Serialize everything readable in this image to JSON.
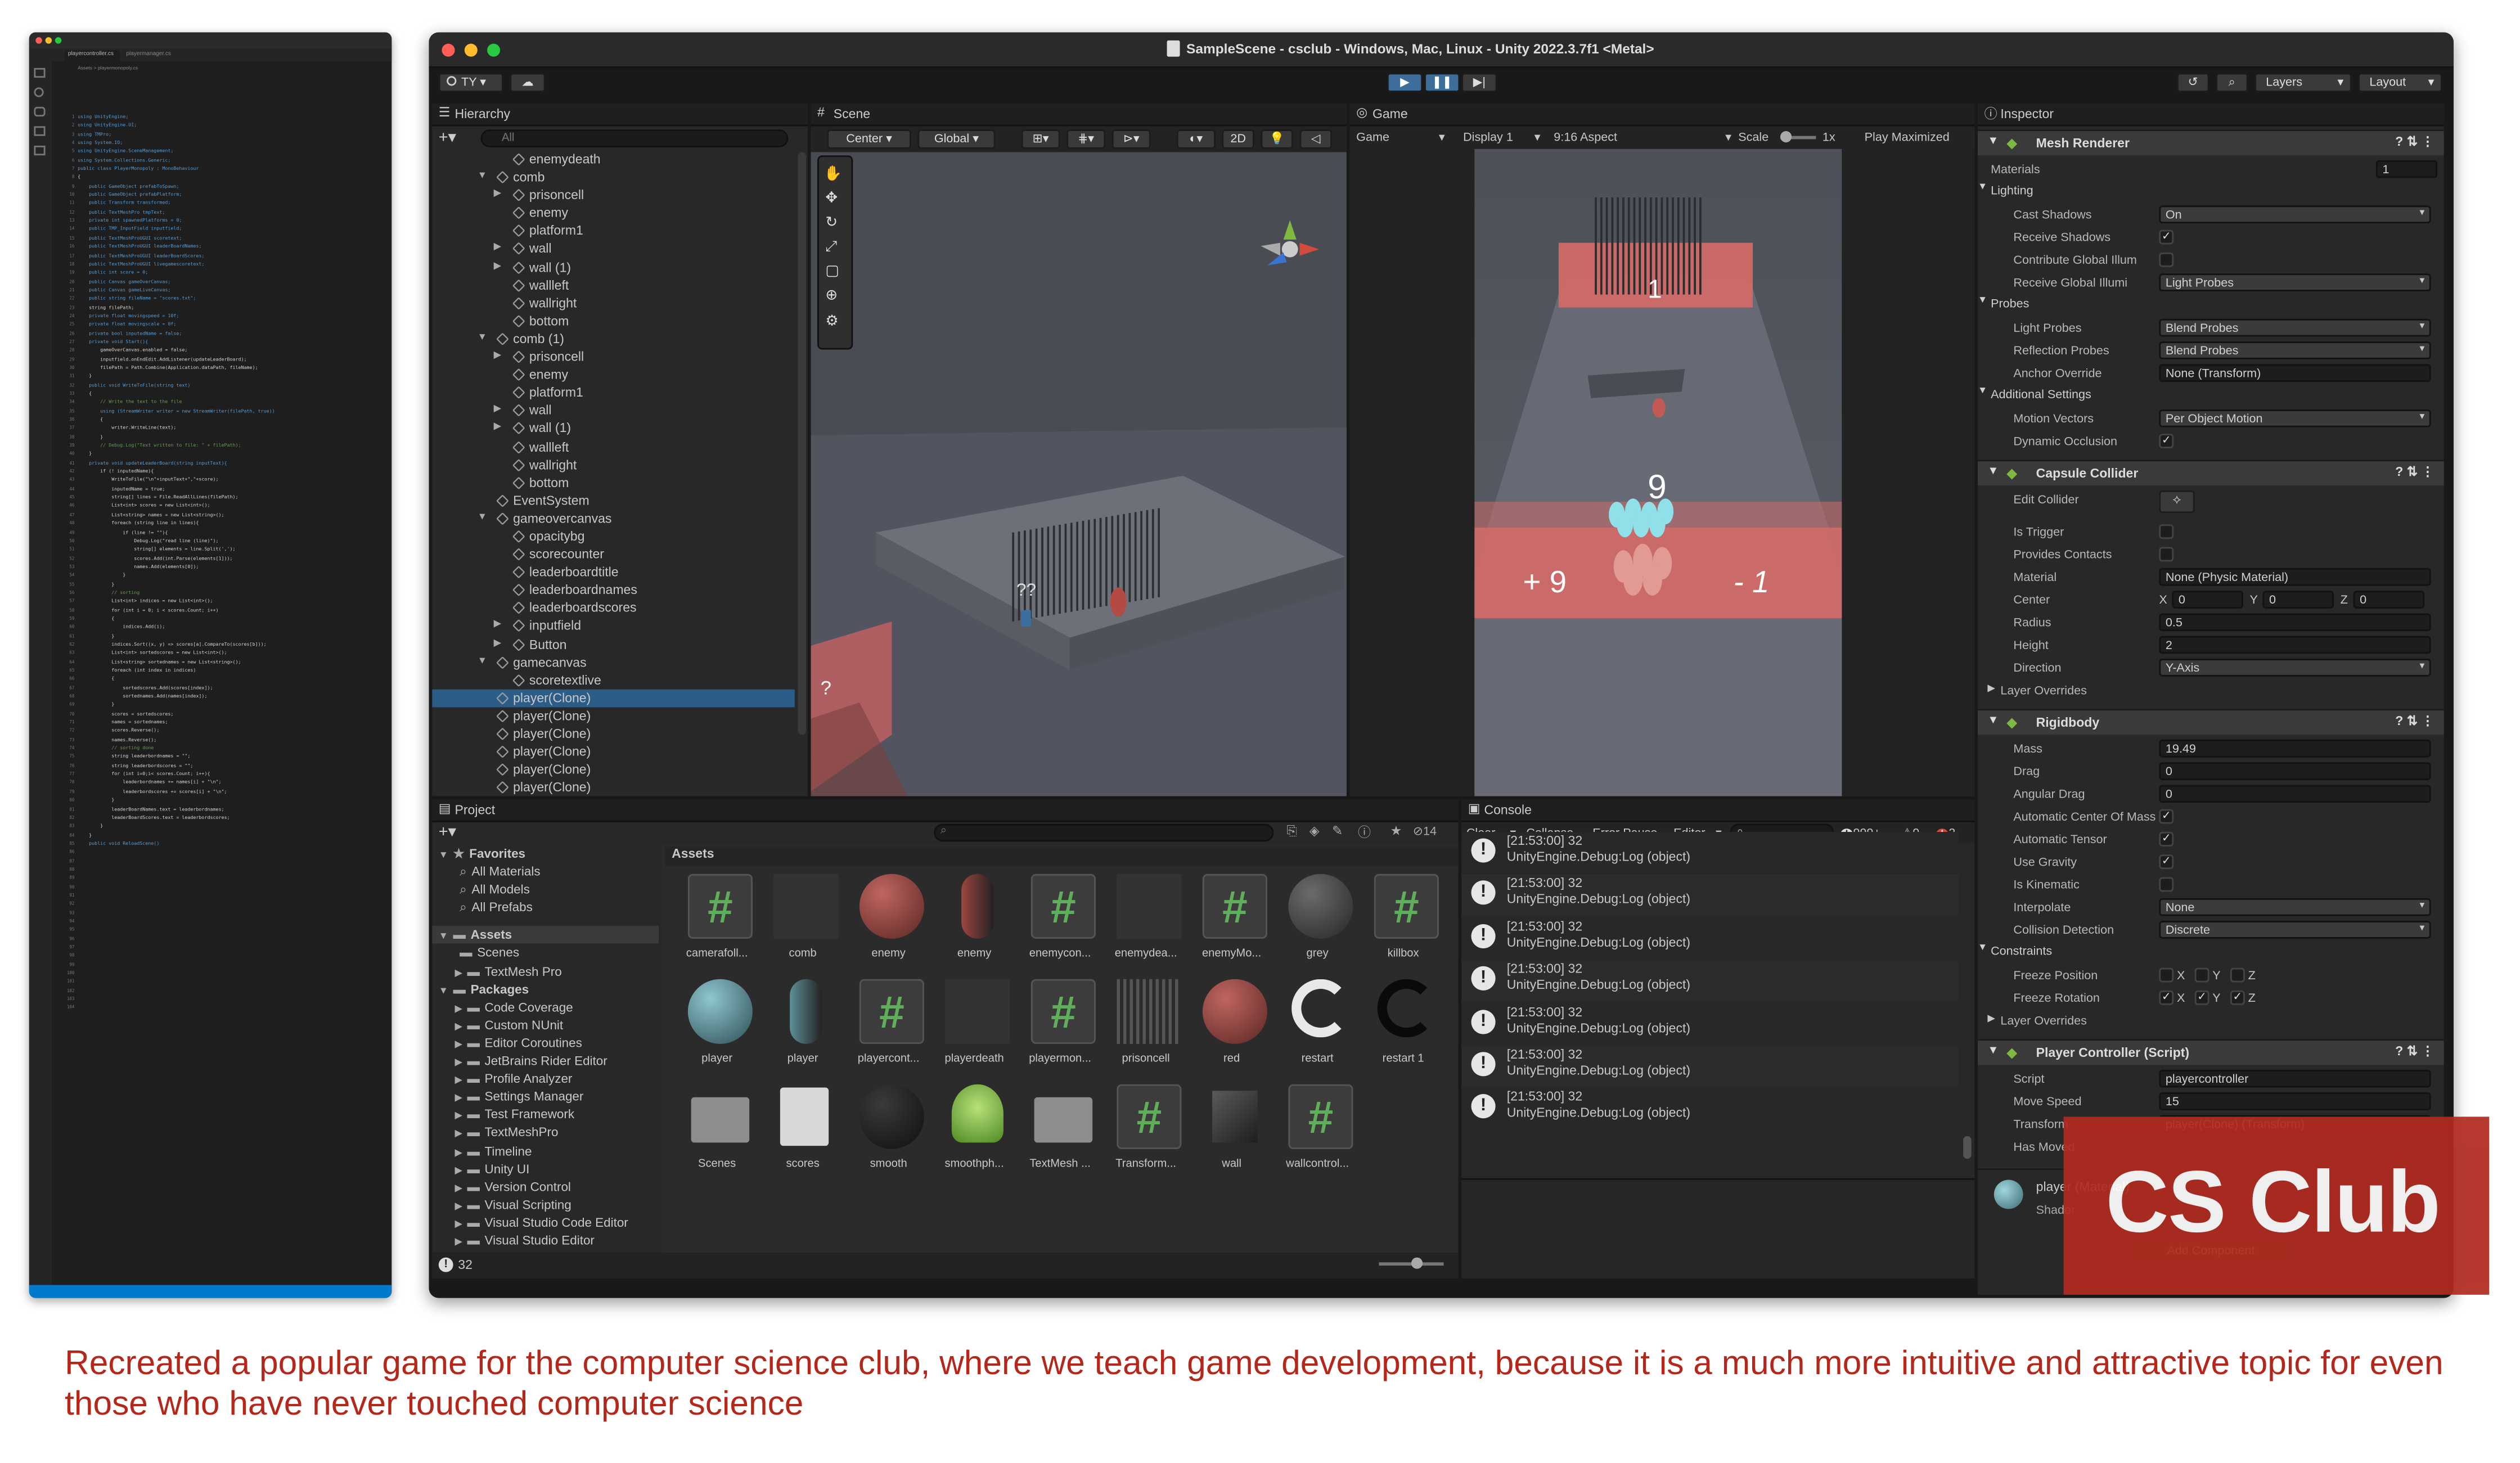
{
  "code_editor": {
    "tab1": "playercontroller.cs",
    "tab2": "playermanager.cs",
    "breadcrumb": "Assets > playermonopoly.cs",
    "lines": [
      "using UnityEngine;",
      "using UnityEngine.UI;",
      "using TMPro;",
      "using System.IO;",
      "using UnityEngine.SceneManagement;",
      "using System.Collections.Generic;",
      "",
      "public class PlayerMonopoly : MonoBehaviour",
      "{",
      "    public GameObject prefabToSpawn;",
      "    public GameObject prefabPlatform;",
      "    public Transform transformed;",
      "    public TextMeshPro tmpText;",
      "    private int spawnedPlatforms = 0;",
      "",
      "    public TMP_InputField inputfield;",
      "    public TextMeshProUGUI scoretext;",
      "    public TextMeshProUGUI leaderBoardNames;",
      "    public TextMeshProUGUI leaderBoardScores;",
      "",
      "    public TextMeshProUGUI livegamescoretext;",
      "",
      "    public int score = 0;",
      "",
      "    public Canvas gameOverCanvas;",
      "    public Canvas gameLiveCanvas;",
      "    public string fileName = \"scores.txt\";",
      "    string filePath;",
      "",
      "    private float movingspeed = 10f;",
      "    private float movingscale = 0f;",
      "",
      "    private bool inputedName = false;",
      "",
      "    private void Start(){",
      "        gameOverCanvas.enabled = false;",
      "        inputfield.onEndEdit.AddListener(updateLeaderBoard);",
      "        filePath = Path.Combine(Application.dataPath, fileName);",
      "    }",
      "",
      "    public void WriteToFile(string text)",
      "    {",
      "        // Write the text to the file",
      "        using (StreamWriter writer = new StreamWriter(filePath, true))",
      "        {",
      "            writer.WriteLine(text);",
      "        }",
      "",
      "        // Debug.Log(\"Text written to file: \" + filePath);",
      "    }",
      "",
      "    private void updateLeaderBoard(string inputText){",
      "        if (! inputedName){",
      "            WriteToFile(\"\\n\"+inputText+\",\"+score);",
      "            inputedName = true;",
      "            string[] lines = File.ReadAllLines(filePath);",
      "            List<int> scores = new List<int>();",
      "            List<string> names = new List<string>();",
      "            foreach (string line in lines){",
      "                if (line != \"\"){",
      "                    Debug.Log(\"read line (line)\");",
      "                    string[] elements = line.Split(',');",
      "                    scores.Add(int.Parse(elements[1]));",
      "                    names.Add(elements[0]);",
      "                }",
      "            }",
      "",
      "            // sorting",
      "            List<int> indices = new List<int>();",
      "            for (int i = 0; i < scores.Count; i++)",
      "            {",
      "                indices.Add(i);",
      "            }",
      "",
      "            indices.Sort((x, y) => scores[a].CompareTo(scores[b]));",
      "",
      "            List<int> sortedscores = new List<int>();",
      "            List<string> sortednames = new List<string>();",
      "",
      "            foreach (int index in indices)",
      "            {",
      "                sortedscores.Add(scores[index]);",
      "                sortednames.Add(names[index]);",
      "            }",
      "",
      "            scores = sortedscores;",
      "            names = sortednames;",
      "",
      "            scores.Reverse();",
      "            names.Reverse();",
      "",
      "            // sorting done",
      "            string leaderbordnames = \"\";",
      "            string leaderbordscores = \"\";",
      "            for (int i=0;i< scores.Count; i++){",
      "                leaderbordnames += names[i] + \"\\n\";",
      "                leaderbordscores += scores[i] + \"\\n\";",
      "            }",
      "            leaderBoardNames.text = leaderbordnames;",
      "            leaderBoardScores.text = leaderbordscores;",
      "        }",
      "    }",
      "",
      "    public void ReloadScene()"
    ]
  },
  "unity": {
    "title": "SampleScene - csclub - Windows, Mac, Linux - Unity 2022.3.7f1 <Metal>",
    "account": "TY",
    "layers_label": "Layers",
    "layout_label": "Layout",
    "hierarchy": {
      "tab": "Hierarchy",
      "search_placeholder": "All",
      "items": [
        {
          "label": "enemydeath",
          "indent": 2
        },
        {
          "label": "comb",
          "indent": 1
        },
        {
          "label": "prisoncell",
          "indent": 2
        },
        {
          "label": "enemy",
          "indent": 2
        },
        {
          "label": "platform1",
          "indent": 2
        },
        {
          "label": "wall",
          "indent": 2
        },
        {
          "label": "wall (1)",
          "indent": 2
        },
        {
          "label": "wallleft",
          "indent": 2
        },
        {
          "label": "wallright",
          "indent": 2
        },
        {
          "label": "bottom",
          "indent": 2
        },
        {
          "label": "comb (1)",
          "indent": 1
        },
        {
          "label": "prisoncell",
          "indent": 2
        },
        {
          "label": "enemy",
          "indent": 2
        },
        {
          "label": "platform1",
          "indent": 2
        },
        {
          "label": "wall",
          "indent": 2
        },
        {
          "label": "wall (1)",
          "indent": 2
        },
        {
          "label": "wallleft",
          "indent": 2
        },
        {
          "label": "wallright",
          "indent": 2
        },
        {
          "label": "bottom",
          "indent": 2
        },
        {
          "label": "EventSystem",
          "indent": 1
        },
        {
          "label": "gameovercanvas",
          "indent": 1
        },
        {
          "label": "opacitybg",
          "indent": 2
        },
        {
          "label": "scorecounter",
          "indent": 2
        },
        {
          "label": "leaderboardtitle",
          "indent": 2
        },
        {
          "label": "leaderboardnames",
          "indent": 2
        },
        {
          "label": "leaderboardscores",
          "indent": 2
        },
        {
          "label": "inputfield",
          "indent": 2
        },
        {
          "label": "Button",
          "indent": 2
        },
        {
          "label": "gamecanvas",
          "indent": 1
        },
        {
          "label": "scoretextlive",
          "indent": 2
        },
        {
          "label": "player(Clone)",
          "indent": 1,
          "selected": true
        },
        {
          "label": "player(Clone)",
          "indent": 1
        },
        {
          "label": "player(Clone)",
          "indent": 1
        },
        {
          "label": "player(Clone)",
          "indent": 1
        },
        {
          "label": "player(Clone)",
          "indent": 1
        },
        {
          "label": "player(Clone)",
          "indent": 1
        }
      ]
    },
    "scene": {
      "tab": "Scene",
      "pivot": "Center",
      "space": "Global",
      "mode_2d": "2D"
    },
    "game": {
      "tab": "Game",
      "mode": "Game",
      "display": "Display 1",
      "aspect": "9:16 Aspect",
      "scale_label": "Scale",
      "scale_value": "1x",
      "play_mode": "Play Maximized",
      "gate_top": "1",
      "count_above": "9",
      "gate_left": "+ 9",
      "gate_right": "- 1"
    },
    "project": {
      "tab": "Project",
      "favorites_label": "Favorites",
      "favorites": [
        "All Materials",
        "All Models",
        "All Prefabs"
      ],
      "assets_label": "Assets",
      "asset_folders": [
        "Scenes",
        "TextMesh Pro"
      ],
      "packages_label": "Packages",
      "packages": [
        "Code Coverage",
        "Custom NUnit",
        "Editor Coroutines",
        "JetBrains Rider Editor",
        "Profile Analyzer",
        "Settings Manager",
        "Test Framework",
        "TextMeshPro",
        "Timeline",
        "Unity UI",
        "Version Control",
        "Visual Scripting",
        "Visual Studio Code Editor",
        "Visual Studio Editor"
      ],
      "grid_title": "Assets",
      "hidden_count": "14",
      "assets": [
        {
          "name": "camerafoll...",
          "kind": "script"
        },
        {
          "name": "comb",
          "kind": "prefab"
        },
        {
          "name": "enemy",
          "kind": "sphere-red"
        },
        {
          "name": "enemy",
          "kind": "capsule-red"
        },
        {
          "name": "enemycon...",
          "kind": "script"
        },
        {
          "name": "enemydea...",
          "kind": "dark"
        },
        {
          "name": "enemyMo...",
          "kind": "script"
        },
        {
          "name": "grey",
          "kind": "sphere-grey"
        },
        {
          "name": "killbox",
          "kind": "script"
        },
        {
          "name": "player",
          "kind": "sphere-teal"
        },
        {
          "name": "player",
          "kind": "capsule-teal"
        },
        {
          "name": "playercont...",
          "kind": "script"
        },
        {
          "name": "playerdeath",
          "kind": "dark"
        },
        {
          "name": "playermon...",
          "kind": "script"
        },
        {
          "name": "prisoncell",
          "kind": "cage"
        },
        {
          "name": "red",
          "kind": "sphere-red"
        },
        {
          "name": "restart",
          "kind": "restart-white"
        },
        {
          "name": "restart 1",
          "kind": "restart-black"
        },
        {
          "name": "Scenes",
          "kind": "folder"
        },
        {
          "name": "scores",
          "kind": "doc"
        },
        {
          "name": "smooth",
          "kind": "sphere-black"
        },
        {
          "name": "smoothph...",
          "kind": "physic"
        },
        {
          "name": "TextMesh ...",
          "kind": "folder"
        },
        {
          "name": "Transform...",
          "kind": "script"
        },
        {
          "name": "wall",
          "kind": "dark-cube"
        },
        {
          "name": "wallcontrol...",
          "kind": "script"
        }
      ],
      "status_count": "32"
    },
    "console": {
      "tab": "Console",
      "clear": "Clear",
      "collapse": "Collapse",
      "error_pause": "Error Pause",
      "editor": "Editor",
      "log_count": "999+",
      "warn_count": "0",
      "error_count": "2",
      "entries": [
        {
          "time": "[21:53:00] 32",
          "msg": "UnityEngine.Debug:Log (object)"
        },
        {
          "time": "[21:53:00] 32",
          "msg": "UnityEngine.Debug:Log (object)"
        },
        {
          "time": "[21:53:00] 32",
          "msg": "UnityEngine.Debug:Log (object)"
        },
        {
          "time": "[21:53:00] 32",
          "msg": "UnityEngine.Debug:Log (object)"
        },
        {
          "time": "[21:53:00] 32",
          "msg": "UnityEngine.Debug:Log (object)"
        },
        {
          "time": "[21:53:00] 32",
          "msg": "UnityEngine.Debug:Log (object)"
        },
        {
          "time": "[21:53:00] 32",
          "msg": "UnityEngine.Debug:Log (object)"
        }
      ]
    },
    "inspector": {
      "tab": "Inspector",
      "mesh_renderer": "Mesh Renderer",
      "materials": {
        "label": "Materials",
        "value": "1"
      },
      "lighting": "Lighting",
      "cast_shadows": {
        "label": "Cast Shadows",
        "value": "On"
      },
      "receive_shadows": "Receive Shadows",
      "contribute_gi": "Contribute Global Illum",
      "receive_gi": {
        "label": "Receive Global Illumi",
        "value": "Light Probes"
      },
      "probes": "Probes",
      "light_probes": {
        "label": "Light Probes",
        "value": "Blend Probes"
      },
      "reflection_probes": {
        "label": "Reflection Probes",
        "value": "Blend Probes"
      },
      "anchor_override": {
        "label": "Anchor Override",
        "value": "None (Transform)"
      },
      "additional_settings": "Additional Settings",
      "motion_vectors": {
        "label": "Motion Vectors",
        "value": "Per Object Motion"
      },
      "dynamic_occlusion": "Dynamic Occlusion",
      "capsule_collider": "Capsule Collider",
      "edit_collider": "Edit Collider",
      "is_trigger": "Is Trigger",
      "provides_contacts": "Provides Contacts",
      "material": {
        "label": "Material",
        "value": "None (Physic Material)"
      },
      "center": {
        "label": "Center",
        "x_label": "X",
        "x": "0",
        "y_label": "Y",
        "y": "0",
        "z_label": "Z",
        "z": "0"
      },
      "radius": {
        "label": "Radius",
        "value": "0.5"
      },
      "height": {
        "label": "Height",
        "value": "2"
      },
      "direction": {
        "label": "Direction",
        "value": "Y-Axis"
      },
      "layer_overrides": "Layer Overrides",
      "rigidbody": "Rigidbody",
      "mass": {
        "label": "Mass",
        "value": "19.49"
      },
      "drag": {
        "label": "Drag",
        "value": "0"
      },
      "angular_drag": {
        "label": "Angular Drag",
        "value": "0"
      },
      "auto_center": "Automatic Center Of Mass",
      "auto_tensor": "Automatic Tensor",
      "use_gravity": "Use Gravity",
      "is_kinematic": "Is Kinematic",
      "interpolate": {
        "label": "Interpolate",
        "value": "None"
      },
      "collision_detection": {
        "label": "Collision Detection",
        "value": "Discrete"
      },
      "constraints": "Constraints",
      "freeze_position": "Freeze Position",
      "freeze_rotation": "Freeze Rotation",
      "axis_x": "X",
      "axis_y": "Y",
      "axis_z": "Z",
      "layer_overrides_2": "Layer Overrides",
      "player_controller": "Player Controller (Script)",
      "script": {
        "label": "Script",
        "value": "playercontroller"
      },
      "move_speed": {
        "label": "Move Speed",
        "value": "15"
      },
      "transform": {
        "label": "Transform",
        "value": "player(Clone) (Transform)"
      },
      "has_moved": "Has Moved",
      "material_preview": "player (Material)",
      "shader": "Shader",
      "add_component": "Add Component"
    }
  },
  "badge": "CS Club",
  "caption": "Recreated a popular game for the computer science club, where we teach game development, because it is a much more intuitive and attractive topic for even those who have never touched computer science"
}
